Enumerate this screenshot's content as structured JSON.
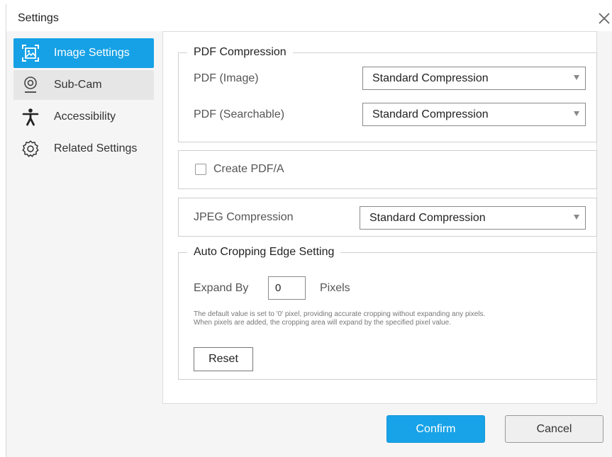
{
  "window": {
    "title": "Settings",
    "close_icon": "close-icon"
  },
  "colors": {
    "accent": "#16a1e6",
    "confirm": "#18a3e8"
  },
  "sidebar": {
    "items": [
      {
        "label": "Image Settings",
        "icon": "image-frame-icon",
        "state": "selected"
      },
      {
        "label": "Sub-Cam",
        "icon": "webcam-icon",
        "state": "hover"
      },
      {
        "label": "Accessibility",
        "icon": "accessibility-icon",
        "state": "normal"
      },
      {
        "label": "Related Settings",
        "icon": "gear-icon",
        "state": "normal"
      }
    ]
  },
  "pdf_compression": {
    "legend": "PDF Compression",
    "pdf_image_label": "PDF (Image)",
    "pdf_image_value": "Standard Compression",
    "pdf_searchable_label": "PDF (Searchable)",
    "pdf_searchable_value": "Standard Compression"
  },
  "pdfa": {
    "label": "Create PDF/A",
    "checked": false
  },
  "jpeg": {
    "label": "JPEG Compression",
    "value": "Standard Compression"
  },
  "auto_crop": {
    "legend": "Auto Cropping Edge Setting",
    "expand_label": "Expand By",
    "expand_value": "0",
    "unit": "Pixels",
    "note_line1": "The default value is set to '0' pixel, providing accurate cropping without expanding any pixels.",
    "note_line2": "When pixels are added, the cropping area will expand by the specified pixel value.",
    "reset_label": "Reset"
  },
  "footer": {
    "confirm_label": "Confirm",
    "cancel_label": "Cancel"
  }
}
